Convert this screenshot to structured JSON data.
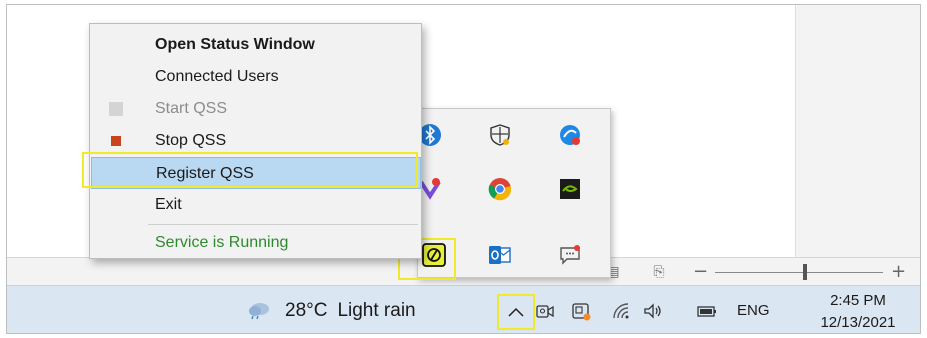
{
  "context_menu": {
    "items": [
      {
        "label": "Open Status Window",
        "state": "default-bold"
      },
      {
        "label": "Connected Users",
        "state": "normal"
      },
      {
        "label": "Start QSS",
        "state": "disabled",
        "icon": "start-square-icon"
      },
      {
        "label": "Stop QSS",
        "state": "normal",
        "icon": "stop-square-icon"
      },
      {
        "label": "Register QSS",
        "state": "highlighted"
      },
      {
        "label": "Exit",
        "state": "normal"
      }
    ],
    "status": "Service is Running"
  },
  "tray_overflow": {
    "icons": [
      "bluetooth-icon",
      "windows-security-icon",
      "tray-app-icon",
      "app-notification-icon",
      "chrome-icon",
      "nvidia-icon",
      "qss-agent-icon",
      "outlook-icon",
      "chat-icon"
    ],
    "highlighted_icon": "qss-agent-icon"
  },
  "taskbar": {
    "weather": {
      "temperature": "28°C",
      "condition": "Light rain"
    },
    "show_hidden_icons": "chevron-up-icon",
    "tray_icons": [
      "meet-now-icon",
      "taskbar-app-icon",
      "wifi-icon",
      "volume-icon",
      "battery-icon"
    ],
    "language": "ENG",
    "time": "2:45 PM",
    "date": "12/13/2021"
  },
  "colors": {
    "highlight_box": "#f0ea2a",
    "menu_selected": "#b9d9f2",
    "status_green": "#2f8a2f",
    "stop_red": "#c8441c",
    "taskbar": "#dbe6f3"
  }
}
